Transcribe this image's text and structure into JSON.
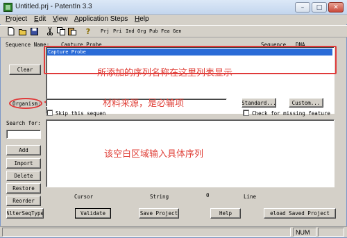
{
  "window": {
    "title": "Untitled.prj - PatentIn 3.3",
    "minimize_glyph": "–",
    "maximize_glyph": "□",
    "close_glyph": "✕"
  },
  "menu": [
    "Project",
    "Edit",
    "View",
    "Application Steps",
    "Help"
  ],
  "toolbar": {
    "icons": [
      "new-file-icon",
      "open-folder-icon",
      "save-disk-icon",
      "cut-icon",
      "copy-icon",
      "paste-icon",
      "help-question-icon"
    ],
    "text_buttons": [
      "Prj",
      "Pri",
      "Ind",
      "Org",
      "Pub",
      "Fea",
      "Gen"
    ]
  },
  "sequence_name": {
    "label": "Sequence Name:",
    "value": "Capture Probe",
    "sequence_label": "Sequence",
    "sequence_type": "DNA"
  },
  "sequence_list": {
    "items": [
      "Capture Probe"
    ]
  },
  "buttons": {
    "clear": "Clear",
    "standard": "Standard...",
    "custom": "Custom...",
    "add": "Add",
    "import": "Import",
    "delete": "Delete",
    "restore": "Restore",
    "reorder": "Reorder",
    "alter_seq_type": "AlterSeqType",
    "validate": "Validate",
    "save_project": "Save Project",
    "help": "Help",
    "reload_saved_project": "eload Saved Project"
  },
  "organism": {
    "label": "Organism:",
    "value": ""
  },
  "checkboxes": {
    "skip": "Skip this sequen",
    "check_missing": "Check for missing feature"
  },
  "search": {
    "label": "Search for:",
    "value": ""
  },
  "info_row": {
    "cursor_label": "Cursor",
    "string_label": "String",
    "string_value": "0",
    "line_label": "Line"
  },
  "annotations": {
    "list_note": "所添加的序列名称在这里列表显示",
    "organism_note": "材料来源，是必输项",
    "editor_note": "该空白区域输入具体序列"
  },
  "status": {
    "num": "NUM"
  },
  "colors": {
    "selection": "#2a6bd7",
    "annotation_red": "#e0423a"
  }
}
